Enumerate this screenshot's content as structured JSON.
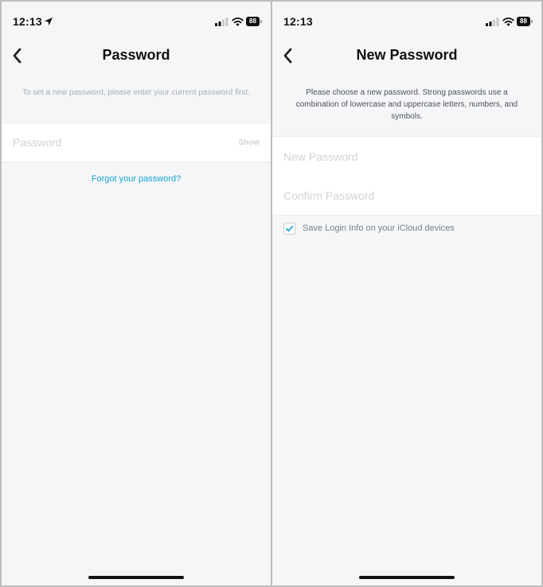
{
  "status_bar": {
    "time": "12:13",
    "battery": "88"
  },
  "left_screen": {
    "title": "Password",
    "description": "To set a new password, please enter your current password first.",
    "password_placeholder": "Password",
    "show_label": "Show",
    "forgot_link": "Forgot your password?"
  },
  "right_screen": {
    "title": "New Password",
    "description": "Please choose a new password. Strong passwords use a combination of lowercase and uppercase letters, numbers, and symbols.",
    "new_password_placeholder": "New Password",
    "confirm_password_placeholder": "Confirm Password",
    "save_login_label": "Save Login Info on your iCloud devices",
    "save_login_checked": true
  },
  "colors": {
    "accent": "#15a4cf",
    "background": "#f5f6f8",
    "placeholder": "#cfd3d7"
  },
  "icons": [
    "location-arrow-icon",
    "signal-icon",
    "wifi-icon",
    "battery-icon",
    "back-chevron-icon",
    "checkmark-icon"
  ]
}
